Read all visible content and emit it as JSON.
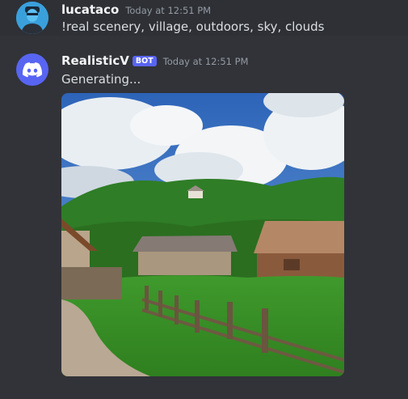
{
  "messages": [
    {
      "username": "lucataco",
      "timestamp": "Today at 12:51 PM",
      "content": "!real scenery, village, outdoors, sky, clouds"
    },
    {
      "username": "RealisticV",
      "bot_tag": "BOT",
      "timestamp": "Today at 12:51 PM",
      "content": "Generating..."
    }
  ],
  "colors": {
    "background": "#313338",
    "hover_background": "#2e3035",
    "blurple": "#5865f2",
    "username": "#f2f3f5",
    "timestamp": "#949ba4",
    "text": "#dbdee1"
  },
  "icons": {
    "user_avatar": "user-avatar-icon",
    "bot_avatar": "discord-logo-icon"
  }
}
